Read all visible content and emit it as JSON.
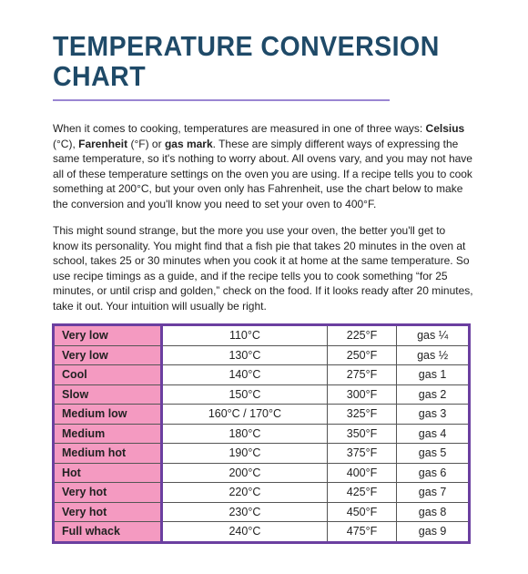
{
  "title_line1": "TEMPERATURE CONVERSION",
  "title_line2": "CHART",
  "p1": {
    "a": "When it comes to cooking, temperatures are measured in one of three ways: ",
    "celsius": "Celsius",
    "b": " (°C), ",
    "fahrenheit": "Farenheit",
    "c": " (°F) or ",
    "gas": "gas mark",
    "d": ". These are simply different ways of expressing the same temperature, so it's nothing to worry about. All ovens vary, and you may not have all of these temperature settings on the oven you are using. If a recipe tells you to cook something at 200°C, but your oven only has Fahrenheit, use the chart below to make the conversion and you'll know you need to set your oven to 400°F."
  },
  "p2": "This might sound strange, but the more you use your oven, the better you'll get to know its personality. You might find that a fish pie that takes 20 minutes in the oven at school, takes 25 or 30 minutes when you cook it at home at the same temperature.  So use recipe timings as a guide, and if the recipe tells you to cook something “for 25 minutes, or until crisp and golden,” check on the food. If it looks ready after 20 minutes, take it out. Your intuition will usually be right.",
  "rows": [
    [
      "Very low",
      "110°C",
      "225°F",
      "gas ¼"
    ],
    [
      "Very low",
      "130°C",
      "250°F",
      "gas ½"
    ],
    [
      "Cool",
      "140°C",
      "275°F",
      "gas 1"
    ],
    [
      "Slow",
      "150°C",
      "300°F",
      "gas 2"
    ],
    [
      "Medium low",
      "160°C / 170°C",
      "325°F",
      "gas 3"
    ],
    [
      "Medium",
      "180°C",
      "350°F",
      "gas 4"
    ],
    [
      "Medium hot",
      "190°C",
      "375°F",
      "gas 5"
    ],
    [
      "Hot",
      "200°C",
      "400°F",
      "gas 6"
    ],
    [
      "Very hot",
      "220°C",
      "425°F",
      "gas 7"
    ],
    [
      "Very hot",
      "230°C",
      "450°F",
      "gas 8"
    ],
    [
      "Full whack",
      "240°C",
      "475°F",
      "gas 9"
    ]
  ],
  "colors": {
    "title": "#1f4a68",
    "rule": "#9a86d2",
    "label_bg": "#f49ac1",
    "table_border": "#6b3fa0"
  }
}
